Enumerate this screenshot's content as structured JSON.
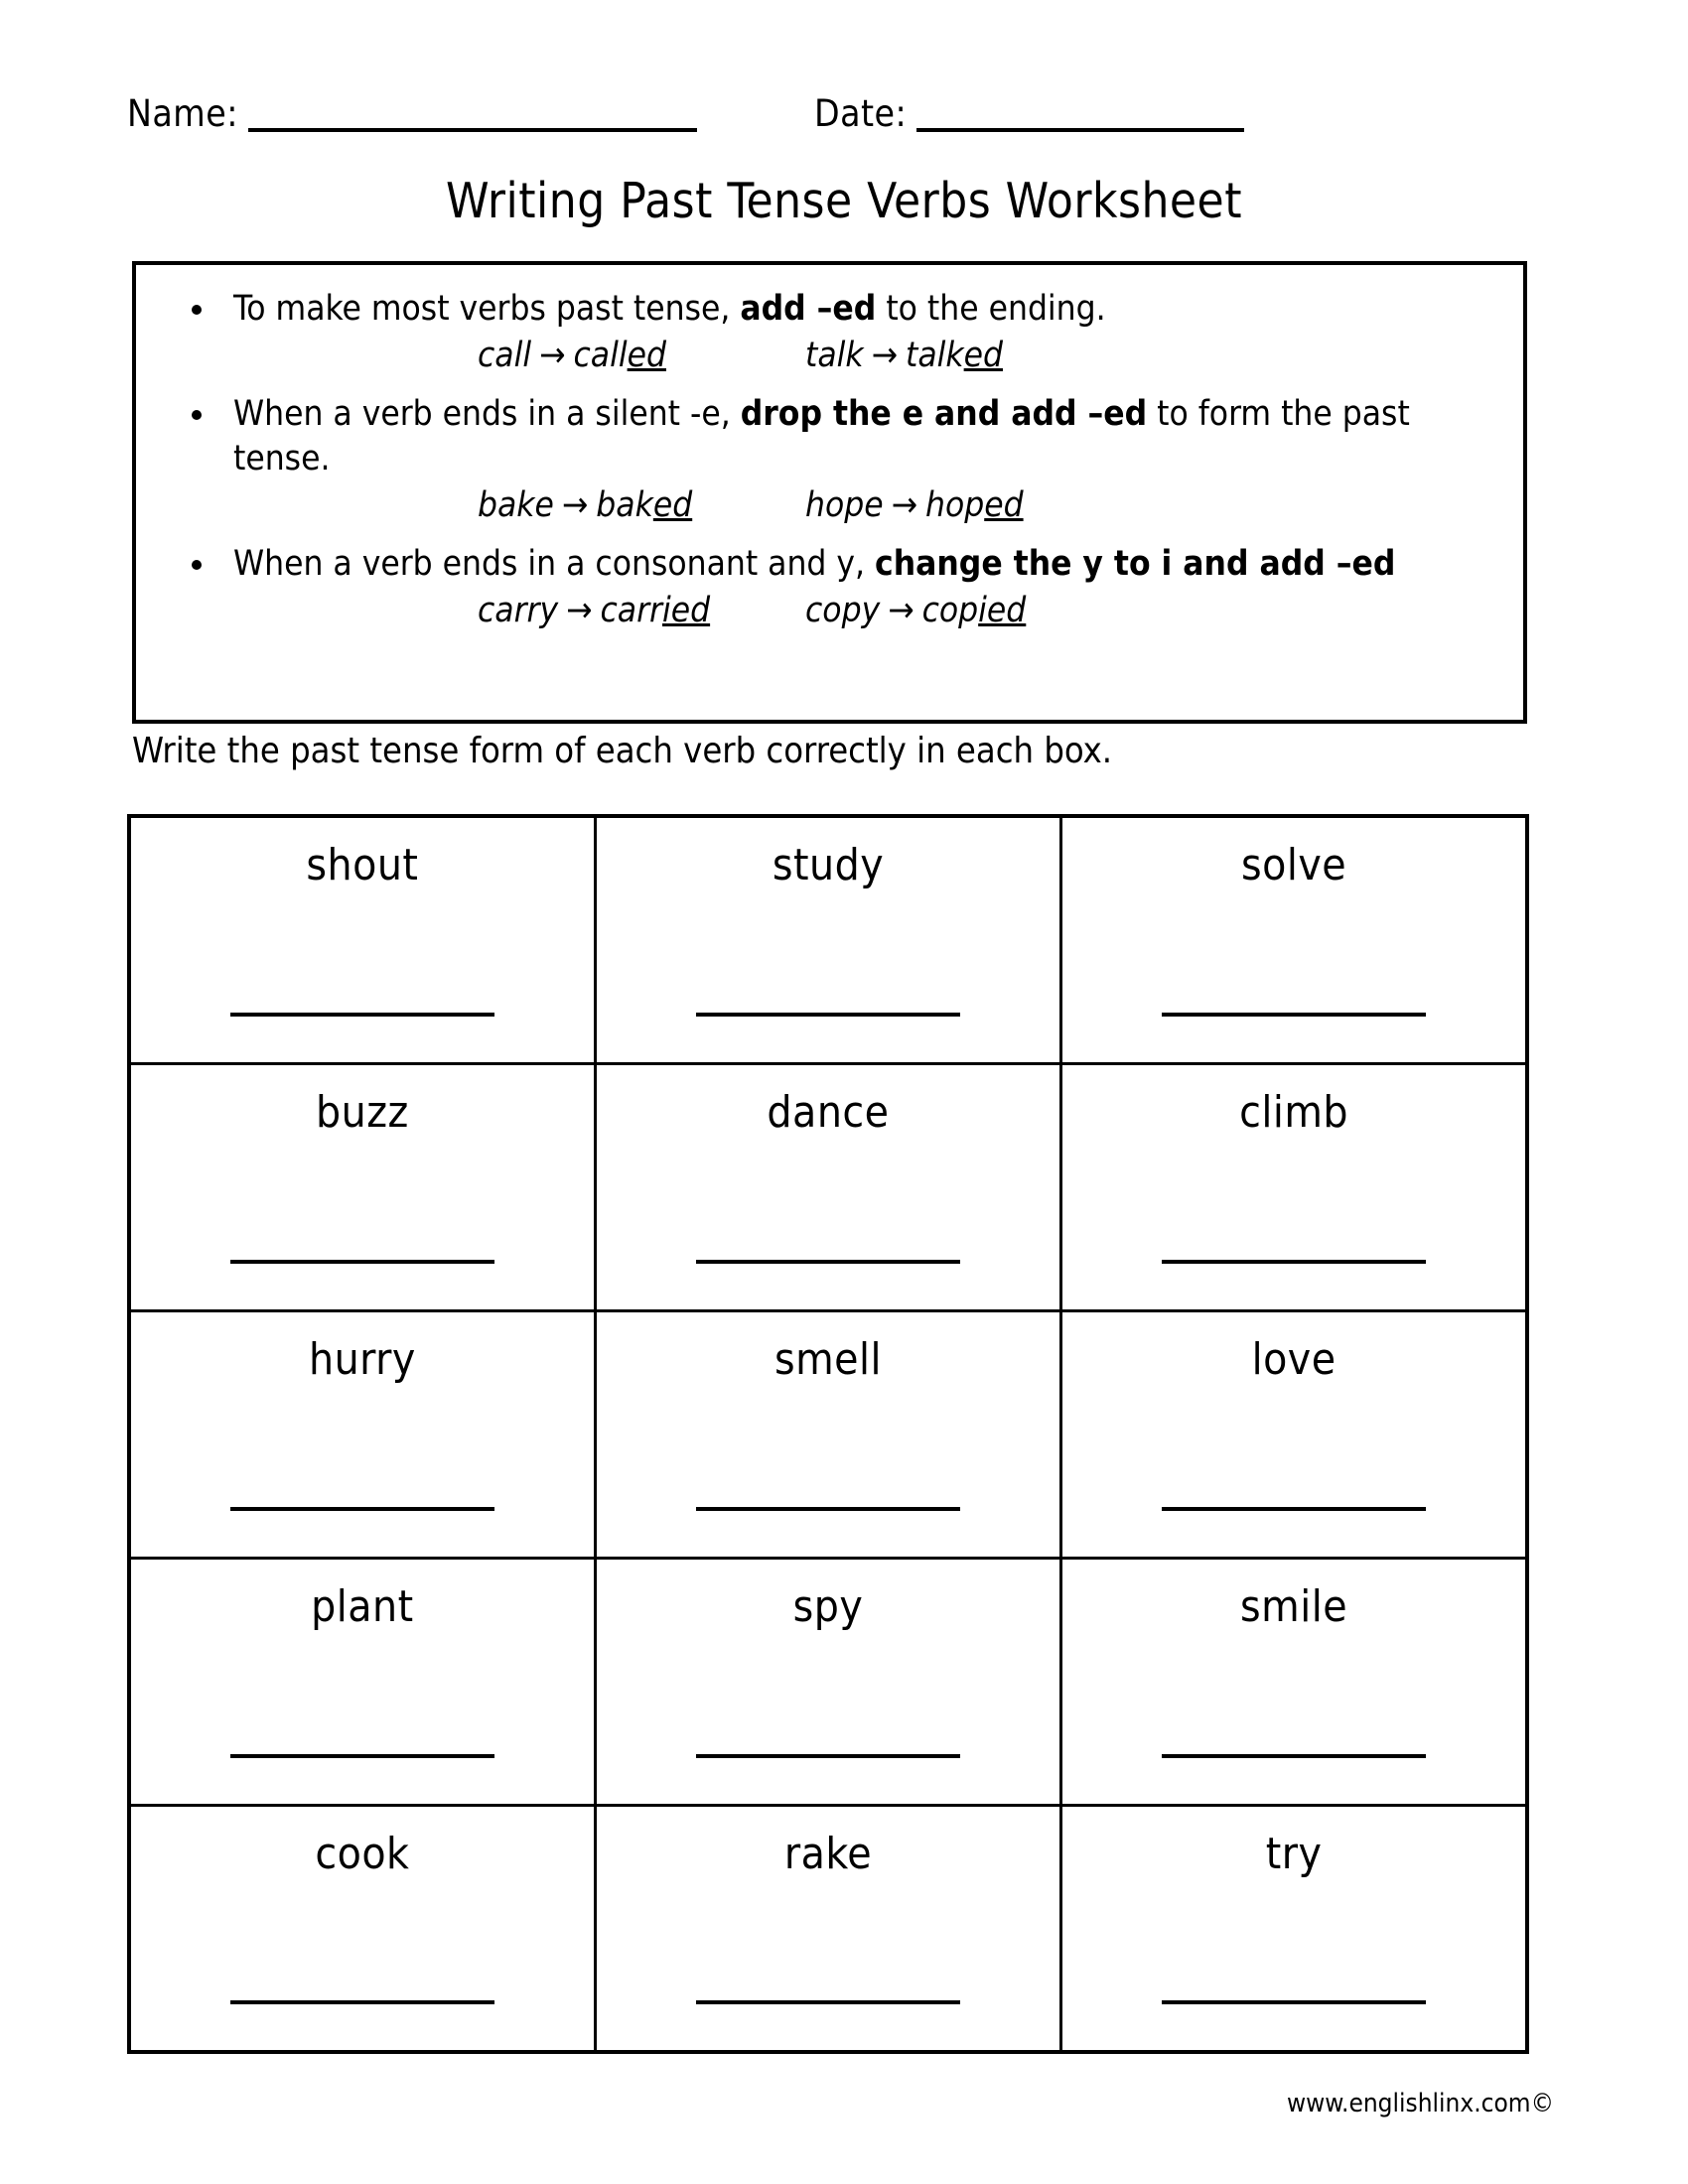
{
  "header": {
    "name_label": "Name:",
    "date_label": "Date:"
  },
  "title": "Writing Past Tense Verbs Worksheet",
  "rules": [
    {
      "text_before": "To make most verbs past tense, ",
      "text_bold": "add –ed",
      "text_after": " to the ending.",
      "examples": [
        {
          "base": "call",
          "arrow": "→",
          "stem": "call",
          "suffix": "ed"
        },
        {
          "base": "talk",
          "arrow": "→",
          "stem": "talk",
          "suffix": "ed"
        }
      ]
    },
    {
      "text_before": "When a verb ends in a silent -e, ",
      "text_bold": "drop the e and add –ed",
      "text_after": " to form the past tense.",
      "examples": [
        {
          "base": "bake",
          "arrow": "→",
          "stem": "bak",
          "suffix": "ed"
        },
        {
          "base": "hope",
          "arrow": "→",
          "stem": "hop",
          "suffix": "ed"
        }
      ]
    },
    {
      "text_before": "When a verb ends in a consonant and y, ",
      "text_bold": "change the y to i and add –ed",
      "text_after": "",
      "examples": [
        {
          "base": "carry",
          "arrow": "→",
          "stem": "carr",
          "suffix": "ied"
        },
        {
          "base": "copy",
          "arrow": "→",
          "stem": "cop",
          "suffix": "ied"
        }
      ]
    }
  ],
  "directions": "Write the past tense form of each verb correctly in each box.",
  "grid": {
    "rows": [
      [
        "shout",
        "study",
        "solve"
      ],
      [
        "buzz",
        "dance",
        "climb"
      ],
      [
        "hurry",
        "smell",
        "love"
      ],
      [
        "plant",
        "spy",
        "smile"
      ],
      [
        "cook",
        "rake",
        "try"
      ]
    ]
  },
  "footer": "www.englishlinx.com©"
}
